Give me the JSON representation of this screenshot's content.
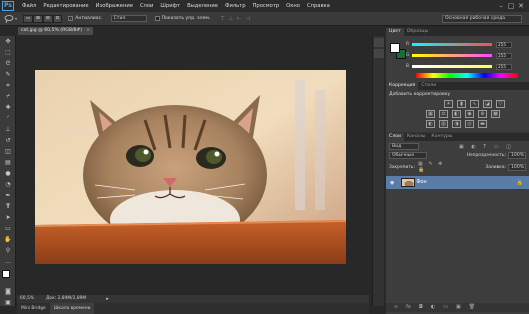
{
  "menubar": {
    "logo": "Ps",
    "menus": [
      "Файл",
      "Редактирование",
      "Изображение",
      "Слои",
      "Шрифт",
      "Выделение",
      "Фильтр",
      "Просмотр",
      "Окно",
      "Справка"
    ],
    "controls": [
      "–",
      "□",
      "✕"
    ]
  },
  "options": {
    "antialias_label": "Антиалиас.",
    "style_value": "Стил",
    "show_label": "Показать упр. элем.",
    "workspace": "Основная рабочая среда"
  },
  "document": {
    "tab_title": "cat.jpg @ 60,5% (RGB/8#)",
    "zoom": "60,5%",
    "doc_size": "Док: 2,89М/2,89М"
  },
  "bottom_tabs": [
    "Mini Bridge",
    "Шкала времени"
  ],
  "color_panel": {
    "tabs": [
      "Цвет",
      "Образцы"
    ],
    "sliders": [
      {
        "label": "R",
        "value": "255",
        "color": "#ff4a4a"
      },
      {
        "label": "G",
        "value": "255",
        "color": "#ff4aff"
      },
      {
        "label": "B",
        "value": "255",
        "color": "#ffff4a"
      }
    ],
    "fg_color": "#ffffff",
    "bg_color": "#1b6b3a"
  },
  "adjustments": {
    "tabs": [
      "Коррекция",
      "Стили"
    ],
    "title": "Добавить корректировку"
  },
  "layers": {
    "tabs": [
      "Слои",
      "Каналы",
      "Контуры"
    ],
    "kind_label": "Вид",
    "blend_mode": "Обычные",
    "opacity_label": "Непрозрачность:",
    "opacity_value": "100%",
    "lock_label": "Закрепить:",
    "fill_label": "Заливка:",
    "fill_value": "100%",
    "layer_name": "Фон"
  }
}
